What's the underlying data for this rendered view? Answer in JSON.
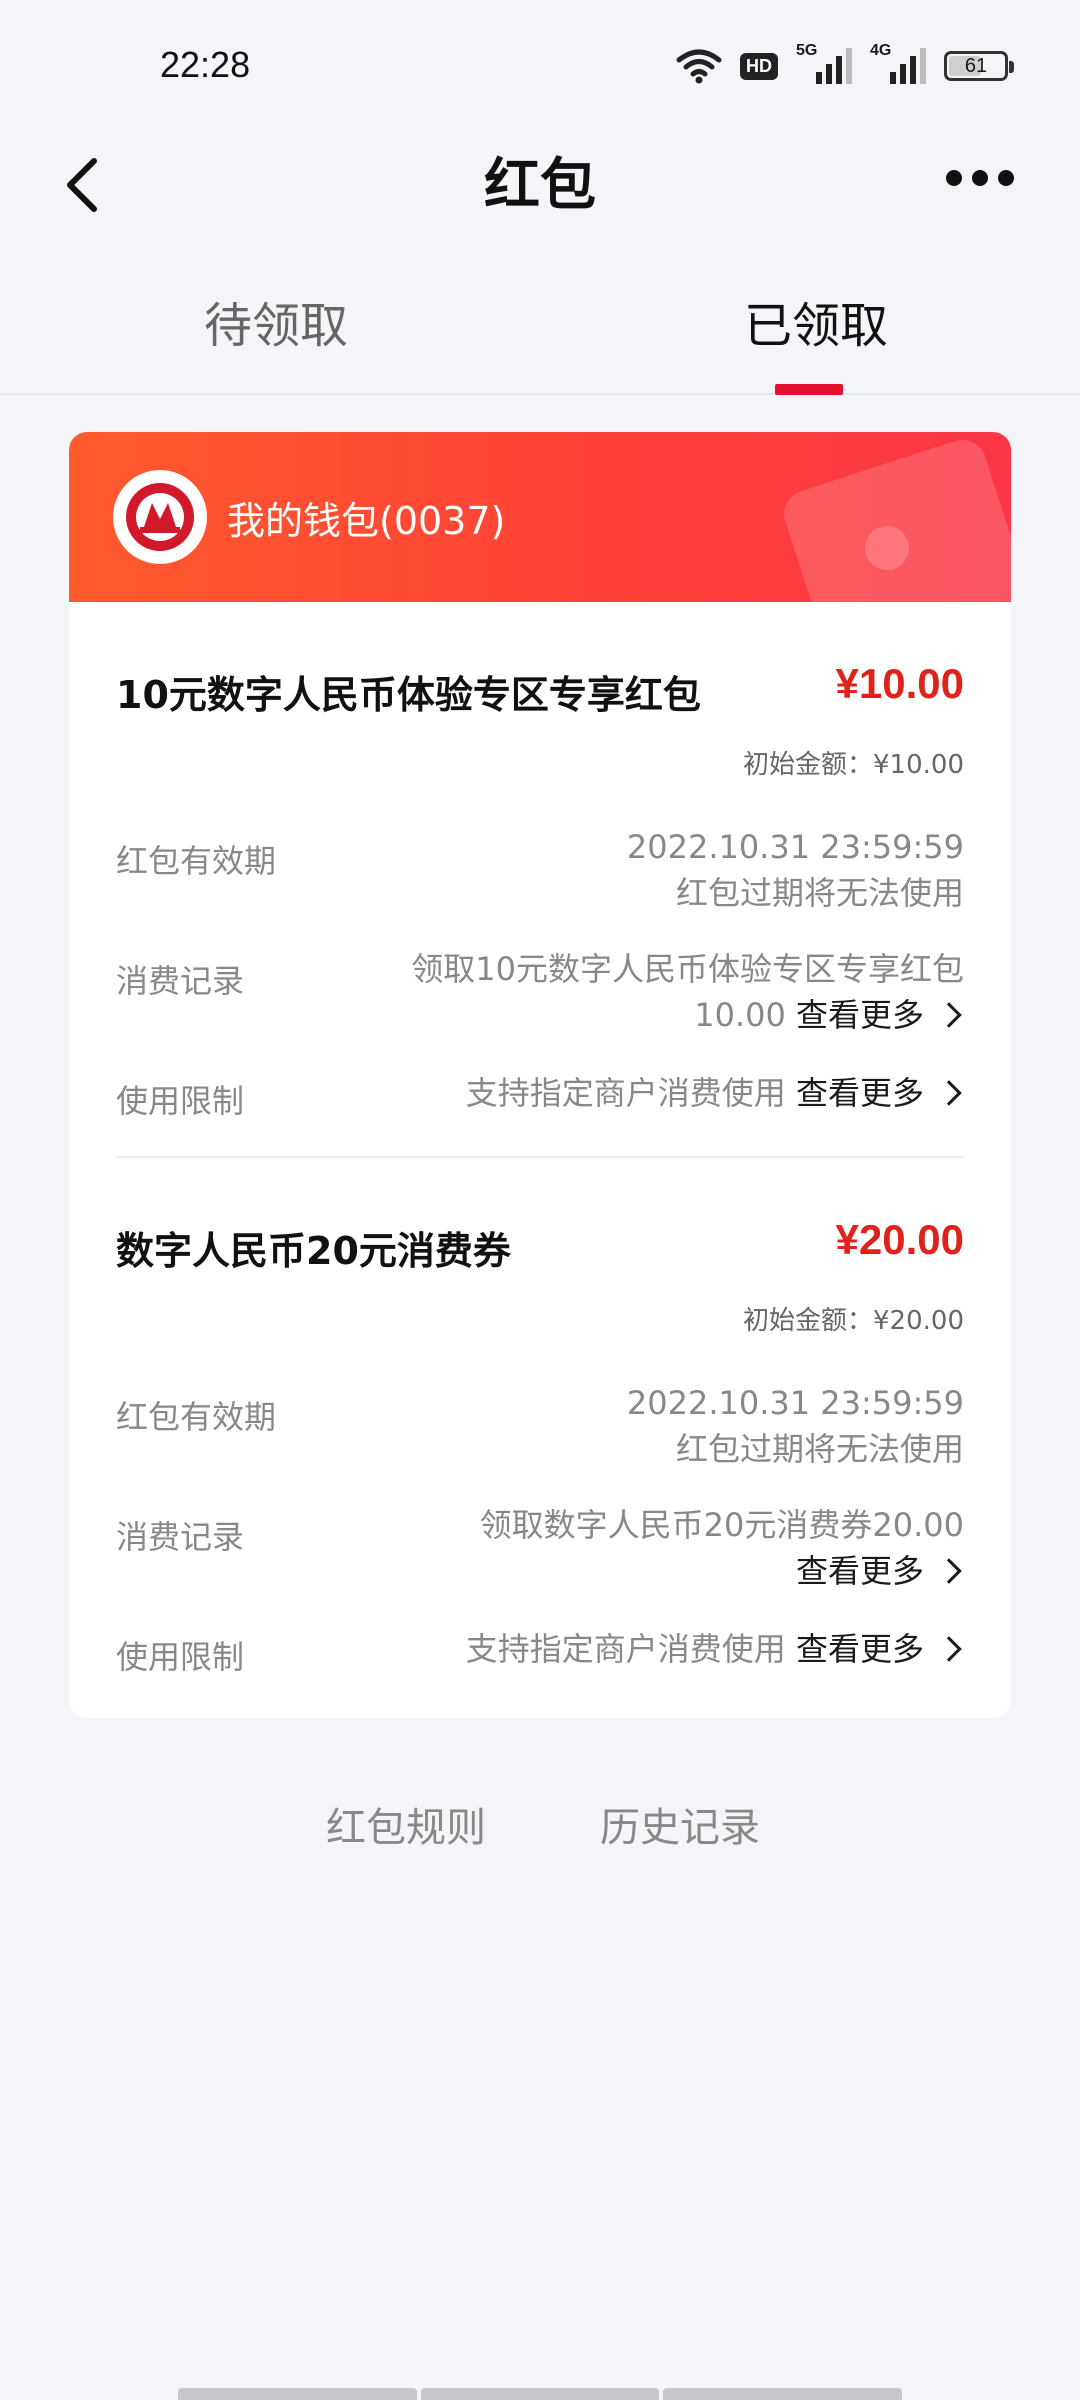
{
  "status_bar": {
    "time": "22:28",
    "hd_label": "HD",
    "net1": "5G",
    "net2": "4G",
    "battery": "61",
    "icons": [
      "wifi-icon",
      "hd-icon",
      "signal-5g-icon",
      "signal-4g-icon",
      "battery-icon"
    ]
  },
  "header": {
    "title": "红包",
    "back_icon": "chevron-left-icon",
    "more_icon": "more-dots-icon"
  },
  "tabs": [
    {
      "label": "待领取",
      "active": false
    },
    {
      "label": "已领取",
      "active": true
    }
  ],
  "colors": {
    "accent": "#e4122f",
    "amount": "#e0221c",
    "header_gradient_start": "#ff5a2d",
    "header_gradient_end": "#fb3547"
  },
  "wallet": {
    "name": "我的钱包(0037)",
    "logo_icon": "bank-logo-icon"
  },
  "packets": [
    {
      "title": "10元数字人民币体验专区专享红包",
      "amount": "¥10.00",
      "initial": "初始金额：¥10.00",
      "validity_label": "红包有效期",
      "validity_date": "2022.10.31 23:59:59",
      "validity_note": "红包过期将无法使用",
      "record_label": "消费记录",
      "record_line1": "领取10元数字人民币体验专区专享红包",
      "record_line2": "10.00",
      "record_more": "查看更多",
      "limit_label": "使用限制",
      "limit_value": "支持指定商户消费使用",
      "limit_more": "查看更多"
    },
    {
      "title": "数字人民币20元消费券",
      "amount": "¥20.00",
      "initial": "初始金额：¥20.00",
      "validity_label": "红包有效期",
      "validity_date": "2022.10.31 23:59:59",
      "validity_note": "红包过期将无法使用",
      "record_label": "消费记录",
      "record_line1": "领取数字人民币20元消费券20.00",
      "record_line2": "",
      "record_more": "查看更多",
      "limit_label": "使用限制",
      "limit_value": "支持指定商户消费使用",
      "limit_more": "查看更多"
    }
  ],
  "footer": {
    "rules": "红包规则",
    "history": "历史记录"
  }
}
